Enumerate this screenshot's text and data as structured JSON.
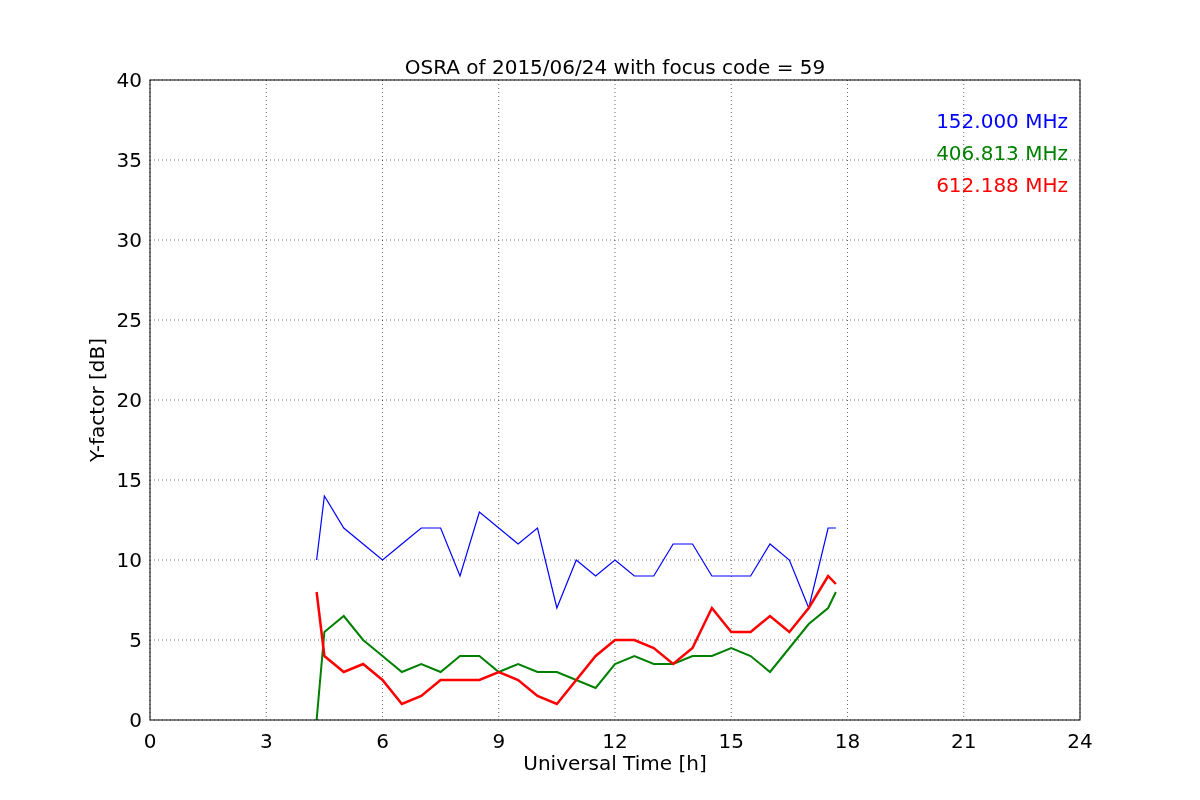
{
  "figure": {
    "chart_data": {
      "type": "line",
      "title": "OSRA of 2015/06/24 with focus code = 59",
      "xlabel": "Universal Time [h]",
      "ylabel": "Y-factor [dB]",
      "xlim": [
        0,
        24
      ],
      "ylim": [
        0,
        40
      ],
      "xticks": [
        0,
        3,
        6,
        9,
        12,
        15,
        18,
        21,
        24
      ],
      "yticks": [
        0,
        5,
        10,
        15,
        20,
        25,
        30,
        35,
        40
      ],
      "grid": true,
      "x": [
        4.3,
        4.5,
        5,
        5.5,
        6,
        6.5,
        7,
        7.5,
        8,
        8.5,
        9,
        9.5,
        10,
        10.5,
        11,
        11.5,
        12,
        12.5,
        13,
        13.5,
        14,
        14.5,
        15,
        15.5,
        16,
        16.5,
        17,
        17.5,
        17.7
      ],
      "series": [
        {
          "name": "152.000 MHz",
          "color": "#0000ff",
          "values": [
            10,
            14,
            12,
            11,
            10,
            11,
            12,
            12,
            9,
            13,
            12,
            11,
            12,
            7,
            10,
            9,
            10,
            9,
            9,
            11,
            11,
            9,
            9,
            9,
            11,
            10,
            7,
            12,
            12
          ]
        },
        {
          "name": "406.813 MHz",
          "color": "#008000",
          "values": [
            0,
            5.5,
            6.5,
            5,
            4,
            3,
            3.5,
            3,
            4,
            4,
            3,
            3.5,
            3,
            3,
            2.5,
            2,
            3.5,
            4,
            3.5,
            3.5,
            4,
            4,
            4.5,
            4,
            3,
            4.5,
            6,
            7,
            8
          ]
        },
        {
          "name": "612.188 MHz",
          "color": "#ff0000",
          "values": [
            8,
            4,
            3,
            3.5,
            2.5,
            1,
            1.5,
            2.5,
            2.5,
            2.5,
            3,
            2.5,
            1.5,
            1,
            2.5,
            4,
            5,
            5,
            4.5,
            3.5,
            4.5,
            7,
            5.5,
            5.5,
            6.5,
            5.5,
            7,
            9,
            8.5
          ]
        }
      ]
    }
  }
}
